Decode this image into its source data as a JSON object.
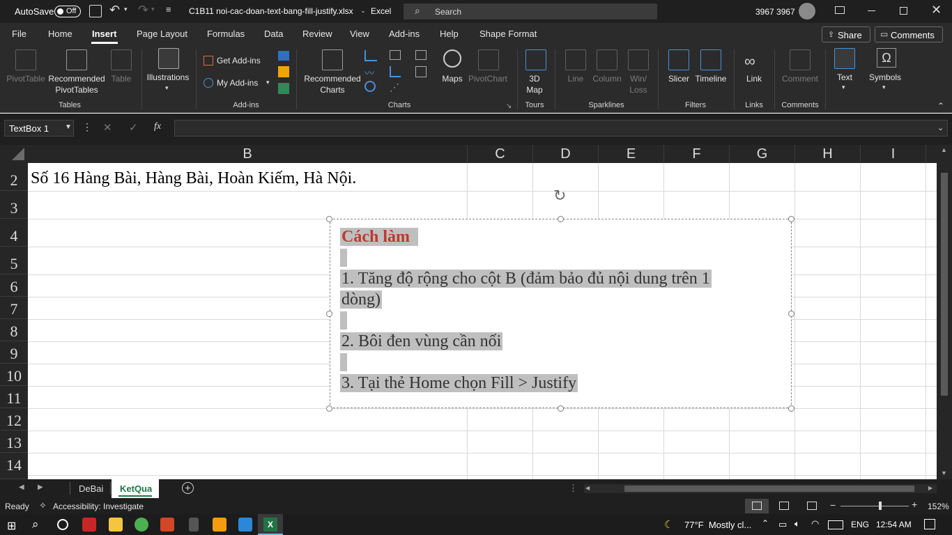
{
  "titlebar": {
    "autosave_label": "AutoSave",
    "autosave_state": "Off",
    "filename": "C1B11 noi-cac-doan-text-bang-fill-justify.xlsx",
    "app_sep": "-",
    "app_name": "Excel",
    "search_placeholder": "Search",
    "user_name": "3967 3967"
  },
  "tabs": [
    "File",
    "Home",
    "Insert",
    "Page Layout",
    "Formulas",
    "Data",
    "Review",
    "View",
    "Add-ins",
    "Help",
    "Shape Format"
  ],
  "active_tab": "Insert",
  "share_label": "Share",
  "comments_label": "Comments",
  "ribbon": {
    "pivottable": "PivotTable",
    "recommended_pivot": "Recommended PivotTables",
    "table": "Table",
    "tables_group": "Tables",
    "illustrations": "Illustrations",
    "get_addins": "Get Add-ins",
    "my_addins": "My Add-ins",
    "addins_group": "Add-ins",
    "recommended_charts": "Recommended Charts",
    "maps": "Maps",
    "pivotchart": "PivotChart",
    "charts_group": "Charts",
    "map3d": "3D Map",
    "tours_group": "Tours",
    "line": "Line",
    "column": "Column",
    "winloss": "Win/ Loss",
    "sparklines_group": "Sparklines",
    "slicer": "Slicer",
    "timeline": "Timeline",
    "filters_group": "Filters",
    "link": "Link",
    "links_group": "Links",
    "comment": "Comment",
    "comments_group": "Comments",
    "text": "Text",
    "symbols": "Symbols"
  },
  "formula_bar": {
    "name_box": "TextBox 1",
    "fx": "fx",
    "value": ""
  },
  "grid": {
    "columns": [
      "B",
      "C",
      "D",
      "E",
      "F",
      "G",
      "H",
      "I"
    ],
    "rows": [
      "2",
      "3",
      "4",
      "5",
      "6",
      "7",
      "8",
      "9",
      "10",
      "11",
      "12",
      "13",
      "14"
    ],
    "cell_b2": "Số 16 Hàng Bài, Hàng Bài, Hoàn Kiếm, Hà Nội."
  },
  "textbox": {
    "heading": "Cách làm",
    "step1_a": "1. Tăng độ rộng cho cột B (đảm bảo đủ nội dung trên 1",
    "step1_b": "dòng)",
    "step2": "2. Bôi đen vùng cần nối",
    "step3": "3. Tại thẻ Home chọn Fill > Justify",
    "heading_color": "#c0392b"
  },
  "sheets": [
    "DeBai",
    "KetQua"
  ],
  "active_sheet": "KetQua",
  "status": {
    "ready": "Ready",
    "accessibility": "Accessibility: Investigate",
    "zoom": "152%"
  },
  "taskbar": {
    "weather": "77°F  Mostly cl...",
    "lang": "ENG",
    "time": "12:54 AM"
  },
  "colors": {
    "ribbon_bg": "#2b2b2b",
    "titlebar_bg": "#1f1f1f",
    "excel_green": "#217346",
    "selection_gray": "#bfbfbf"
  }
}
